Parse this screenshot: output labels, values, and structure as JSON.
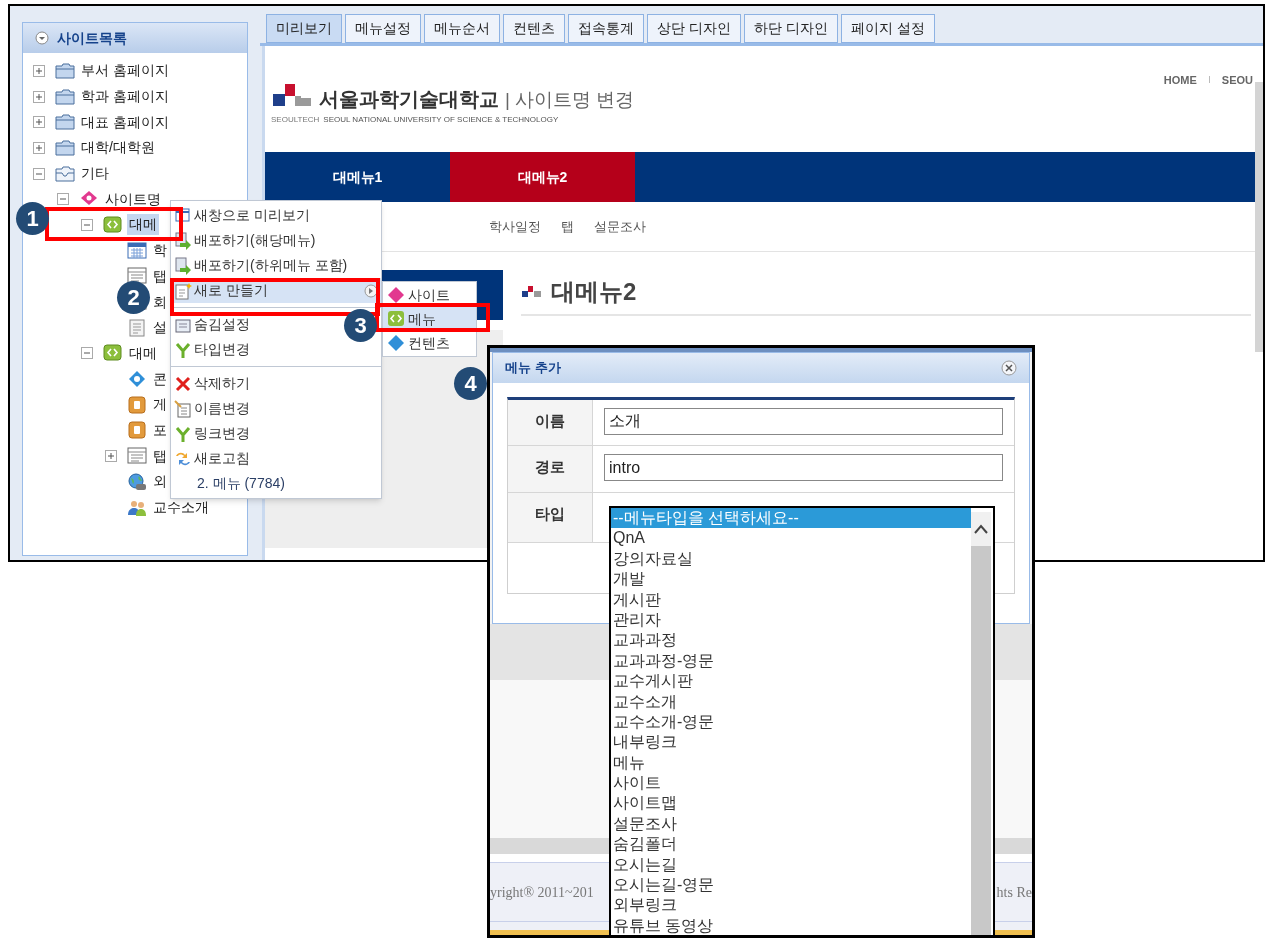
{
  "sidebar": {
    "title": "사이트목록",
    "tree": [
      {
        "label": "부서 홈페이지",
        "kind": "folder",
        "expanded": false,
        "selected": false
      },
      {
        "label": "학과 홈페이지",
        "kind": "folder",
        "expanded": false,
        "selected": false
      },
      {
        "label": "대표 홈페이지",
        "kind": "folder",
        "expanded": false,
        "selected": false
      },
      {
        "label": "대학/대학원",
        "kind": "folder",
        "expanded": false,
        "selected": false
      },
      {
        "label": "기타",
        "kind": "folder-open",
        "expanded": true,
        "selected": false,
        "children": [
          {
            "label": "사이트명",
            "kind": "site",
            "expanded": true,
            "selected": false,
            "children": [
              {
                "label": "대메",
                "kind": "menu",
                "expanded": true,
                "selected": true,
                "children": [
                  {
                    "label": "학",
                    "kind": "calendar",
                    "selected": false
                  },
                  {
                    "label": "탭",
                    "kind": "tab",
                    "selected": false
                  },
                  {
                    "label": "회",
                    "kind": "tab",
                    "selected": false
                  },
                  {
                    "label": "설",
                    "kind": "page",
                    "selected": false
                  }
                ]
              },
              {
                "label": "대메",
                "kind": "menu",
                "expanded": true,
                "selected": false,
                "children": [
                  {
                    "label": "콘",
                    "kind": "content",
                    "selected": false
                  },
                  {
                    "label": "게",
                    "kind": "board",
                    "selected": false
                  },
                  {
                    "label": "포",
                    "kind": "board",
                    "selected": false
                  },
                  {
                    "label": "탭",
                    "kind": "tab",
                    "expanded": false,
                    "selected": false
                  },
                  {
                    "label": "외",
                    "kind": "link",
                    "selected": false
                  },
                  {
                    "label": "교수소개",
                    "kind": "people",
                    "selected": false
                  }
                ]
              }
            ]
          }
        ]
      }
    ]
  },
  "tabs": [
    {
      "label": "미리보기",
      "selected": true
    },
    {
      "label": "메뉴설정",
      "selected": false
    },
    {
      "label": "메뉴순서",
      "selected": false
    },
    {
      "label": "컨텐츠",
      "selected": false
    },
    {
      "label": "접속통계",
      "selected": false
    },
    {
      "label": "상단 디자인",
      "selected": false
    },
    {
      "label": "하단 디자인",
      "selected": false
    },
    {
      "label": "페이지 설정",
      "selected": false
    }
  ],
  "preview": {
    "logo_name": "서울과학기술대학교",
    "logo_tag": "SEOULTECH",
    "logo_subtitle": "SEOUL NATIONAL UNIVERSITY OF SCIENCE & TECHNOLOGY",
    "site_name": "| 사이트명 변경",
    "top_links": [
      "HOME",
      "SEOU"
    ],
    "nav": [
      {
        "label": "대메뉴1",
        "selected": false
      },
      {
        "label": "대메뉴2",
        "selected": true
      }
    ],
    "subnav": [
      "학사일정",
      "탭",
      "설문조사"
    ],
    "page_title": "대메뉴2",
    "footer": [
      "yright® 2011~201",
      "hts Re"
    ]
  },
  "context_menu": {
    "groups": [
      [
        {
          "label": "새창으로 미리보기",
          "kind": "action",
          "selected": false
        },
        {
          "label": "배포하기(해당메뉴)",
          "kind": "action",
          "selected": false
        },
        {
          "label": "배포하기(하위메뉴 포함)",
          "kind": "action",
          "selected": false
        },
        {
          "label": "새로 만들기",
          "kind": "submenu",
          "selected": true
        }
      ],
      [
        {
          "label": "숨김설정",
          "kind": "action",
          "selected": false
        },
        {
          "label": "타입변경",
          "kind": "action",
          "selected": false
        }
      ],
      [
        {
          "label": "삭제하기",
          "kind": "action",
          "selected": false
        },
        {
          "label": "이름변경",
          "kind": "action",
          "selected": false
        },
        {
          "label": "링크변경",
          "kind": "action",
          "selected": false
        },
        {
          "label": "새로고침",
          "kind": "action",
          "selected": false
        },
        {
          "label": "2. 메뉴 (7784)",
          "kind": "info",
          "selected": false
        }
      ]
    ]
  },
  "submenu": [
    {
      "label": "사이트",
      "selected": false
    },
    {
      "label": "메뉴",
      "selected": true
    },
    {
      "label": "컨텐츠",
      "selected": false
    }
  ],
  "dialog": {
    "title": "메뉴 추가",
    "fields": [
      {
        "label": "이름",
        "kind": "text",
        "value": "소개"
      },
      {
        "label": "경로",
        "kind": "text",
        "value": "intro"
      },
      {
        "label": "타입",
        "kind": "listbox",
        "options": [
          {
            "label": "--메뉴타입을 선택하세요--",
            "selected": true
          },
          {
            "label": "QnA",
            "selected": false
          },
          {
            "label": "강의자료실",
            "selected": false
          },
          {
            "label": "개발",
            "selected": false
          },
          {
            "label": "게시판",
            "selected": false
          },
          {
            "label": "관리자",
            "selected": false
          },
          {
            "label": "교과과정",
            "selected": false
          },
          {
            "label": "교과과정-영문",
            "selected": false
          },
          {
            "label": "교수게시판",
            "selected": false
          },
          {
            "label": "교수소개",
            "selected": false
          },
          {
            "label": "교수소개-영문",
            "selected": false
          },
          {
            "label": "내부링크",
            "selected": false
          },
          {
            "label": "메뉴",
            "selected": false
          },
          {
            "label": "사이트",
            "selected": false
          },
          {
            "label": "사이트맵",
            "selected": false
          },
          {
            "label": "설문조사",
            "selected": false
          },
          {
            "label": "숨김폴더",
            "selected": false
          },
          {
            "label": "오시는길",
            "selected": false
          },
          {
            "label": "오시는길-영문",
            "selected": false
          },
          {
            "label": "외부링크",
            "selected": false
          },
          {
            "label": "유튜브 동영상",
            "selected": false
          }
        ]
      }
    ]
  },
  "callouts": [
    "1",
    "2",
    "3",
    "4"
  ]
}
